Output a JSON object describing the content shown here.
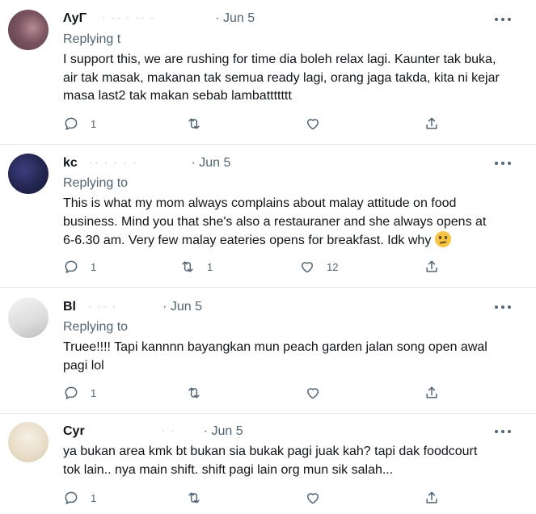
{
  "tweets": [
    {
      "name": "ΛyΓ",
      "handle": "·  ·· · ·· ·",
      "date": "Jun 5",
      "reply_label": "Replying t",
      "text_lines": [
        "I support this, we are rushing for time dia boleh relax lagi. Kaunter tak buka,",
        "air tak masak, makanan tak semua ready lagi, orang jaga takda, kita ni kejar",
        "masa last2 tak makan sebab lambattttttt"
      ],
      "counts": {
        "reply": "1",
        "retweet": "",
        "like": ""
      }
    },
    {
      "name": "kc",
      "handle": "·· · · ·  ·",
      "date": "Jun 5",
      "reply_label": "Replying to",
      "text_lines": [
        "This is what my mom always complains about malay attitude on food",
        "business. Mind you that she's also a restauraner and she always opens at",
        "6-6.30 am. Very few malay eateries opens for breakfast. Idk why"
      ],
      "emoji": "confused-face-emoji",
      "counts": {
        "reply": "1",
        "retweet": "1",
        "like": "12"
      }
    },
    {
      "name": "Bl",
      "handle": "·  ·· ·",
      "date": "Jun 5",
      "reply_label": "Replying to",
      "text_lines": [
        "Truee!!!! Tapi kannnn bayangkan mun peach garden jalan song open awal",
        "pagi lol"
      ],
      "counts": {
        "reply": "1",
        "retweet": "",
        "like": ""
      }
    },
    {
      "name": "Cyr",
      "handle": "·  ·",
      "date": "Jun 5",
      "reply_label": "",
      "text_lines": [
        "ya bukan area kmk bt bukan sia bukak pagi juak kah? tapi dak foodcourt",
        "tok lain.. nya main shift. shift pagi lain org mun sik salah..."
      ],
      "counts": {
        "reply": "1",
        "retweet": "",
        "like": ""
      }
    }
  ],
  "dot_separator": "·",
  "icons": [
    "reply-icon",
    "retweet-icon",
    "like-icon",
    "share-icon",
    "more-icon"
  ],
  "colors": {
    "text": "#0f1419",
    "secondary": "#536471",
    "divider": "#e6e9eb"
  }
}
